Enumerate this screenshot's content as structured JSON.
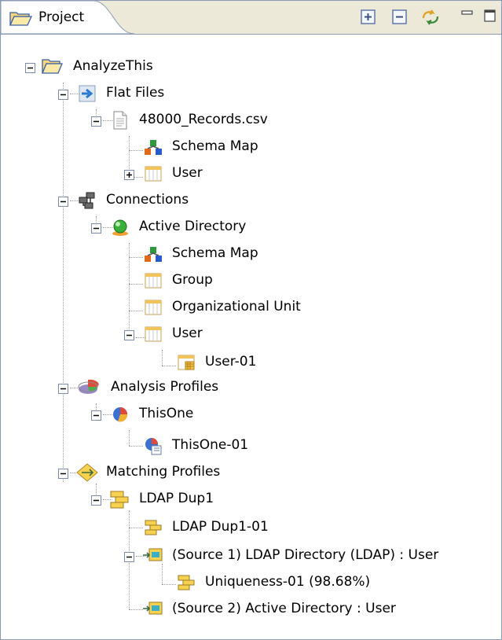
{
  "view": {
    "tab_title": "Project",
    "toolbar": [
      "expand-all",
      "collapse-all",
      "link-with-editor",
      "minimize",
      "maximize"
    ]
  },
  "tree": {
    "root": "AnalyzeThis",
    "flat_files": "Flat Files",
    "csv": "48000_Records.csv",
    "csv_schema": "Schema Map",
    "csv_user": "User",
    "connections": "Connections",
    "ad": "Active Directory",
    "ad_schema": "Schema Map",
    "ad_group": "Group",
    "ad_ou": "Organizational Unit",
    "ad_user": "User",
    "ad_user01": "User-01",
    "analysis": "Analysis Profiles",
    "thisone": "ThisOne",
    "thisone01": "ThisOne-01",
    "matching": "Matching Profiles",
    "ldapdup": "LDAP Dup1",
    "ldapdup01": "LDAP Dup1-01",
    "source1": "(Source 1) LDAP Directory (LDAP) : User",
    "uniqueness": "Uniqueness-01 (98.68%)",
    "source2": "(Source 2) Active Directory : User"
  }
}
